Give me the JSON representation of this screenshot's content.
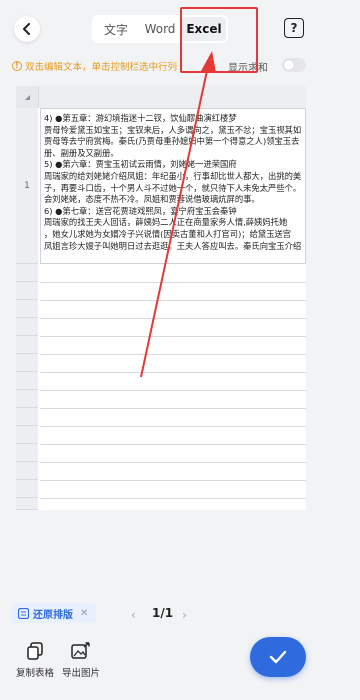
{
  "header": {
    "tabs": [
      {
        "label": "文字"
      },
      {
        "label": "Word"
      },
      {
        "label": "Excel"
      }
    ],
    "help_glyph": "?"
  },
  "tip": {
    "text": "双击编辑文本，单击控制栏选中行列",
    "toggle_label": "显示求和"
  },
  "sheet": {
    "row_label": "1",
    "cell_lines": [
      "4) ●第五章：游幻境指迷十二钗，饮仙醪曲演红楼梦",
      "贾母怜爱黛玉如宝玉；宝钗来后，人多谓向之，黛玉不忿；宝玉视其如",
      "贾母等去宁府赏梅。秦氏(乃贾母重孙媳妇中第一个得意之人)领宝玉去",
      "册、副册及又副册。",
      "5) ●第六章：贾宝玉初试云雨情，刘姥姥一进荣国府",
      "周瑞家的给刘姥姥介绍凤姐：年纪虽小，行事却比世人都大，出挑的美",
      "子，再要斗口齿，十个男人斗不过她一个，就只待下人未免太严些个。",
      "会刘姥姥，态度不热不冷。凤姐和贾蓉说借玻璃炕屏的事。",
      "6) ●第七章：送宫花贾琏戏熙凤，宴宁府宝玉会秦钟",
      "周瑞家的找王夫人回话，薛姨妈二人正在商量家务人情,薛姨妈托她",
      "，她女儿求她为女婿冷子兴说情(因卖古董和人打官司)；给黛玉送宫",
      "凤姐言珍大嫂子叫她明日过去逛逛。王夫人答应叫去。秦氏向宝玉介绍"
    ]
  },
  "pager": {
    "restore_label": "还原排版",
    "page_text": "1/1"
  },
  "bottom": {
    "copy_label": "复制表格",
    "export_label": "导出图片"
  },
  "colors": {
    "accent": "#2f6bdf",
    "warning": "#e69b1d",
    "annotation": "#e53935"
  }
}
